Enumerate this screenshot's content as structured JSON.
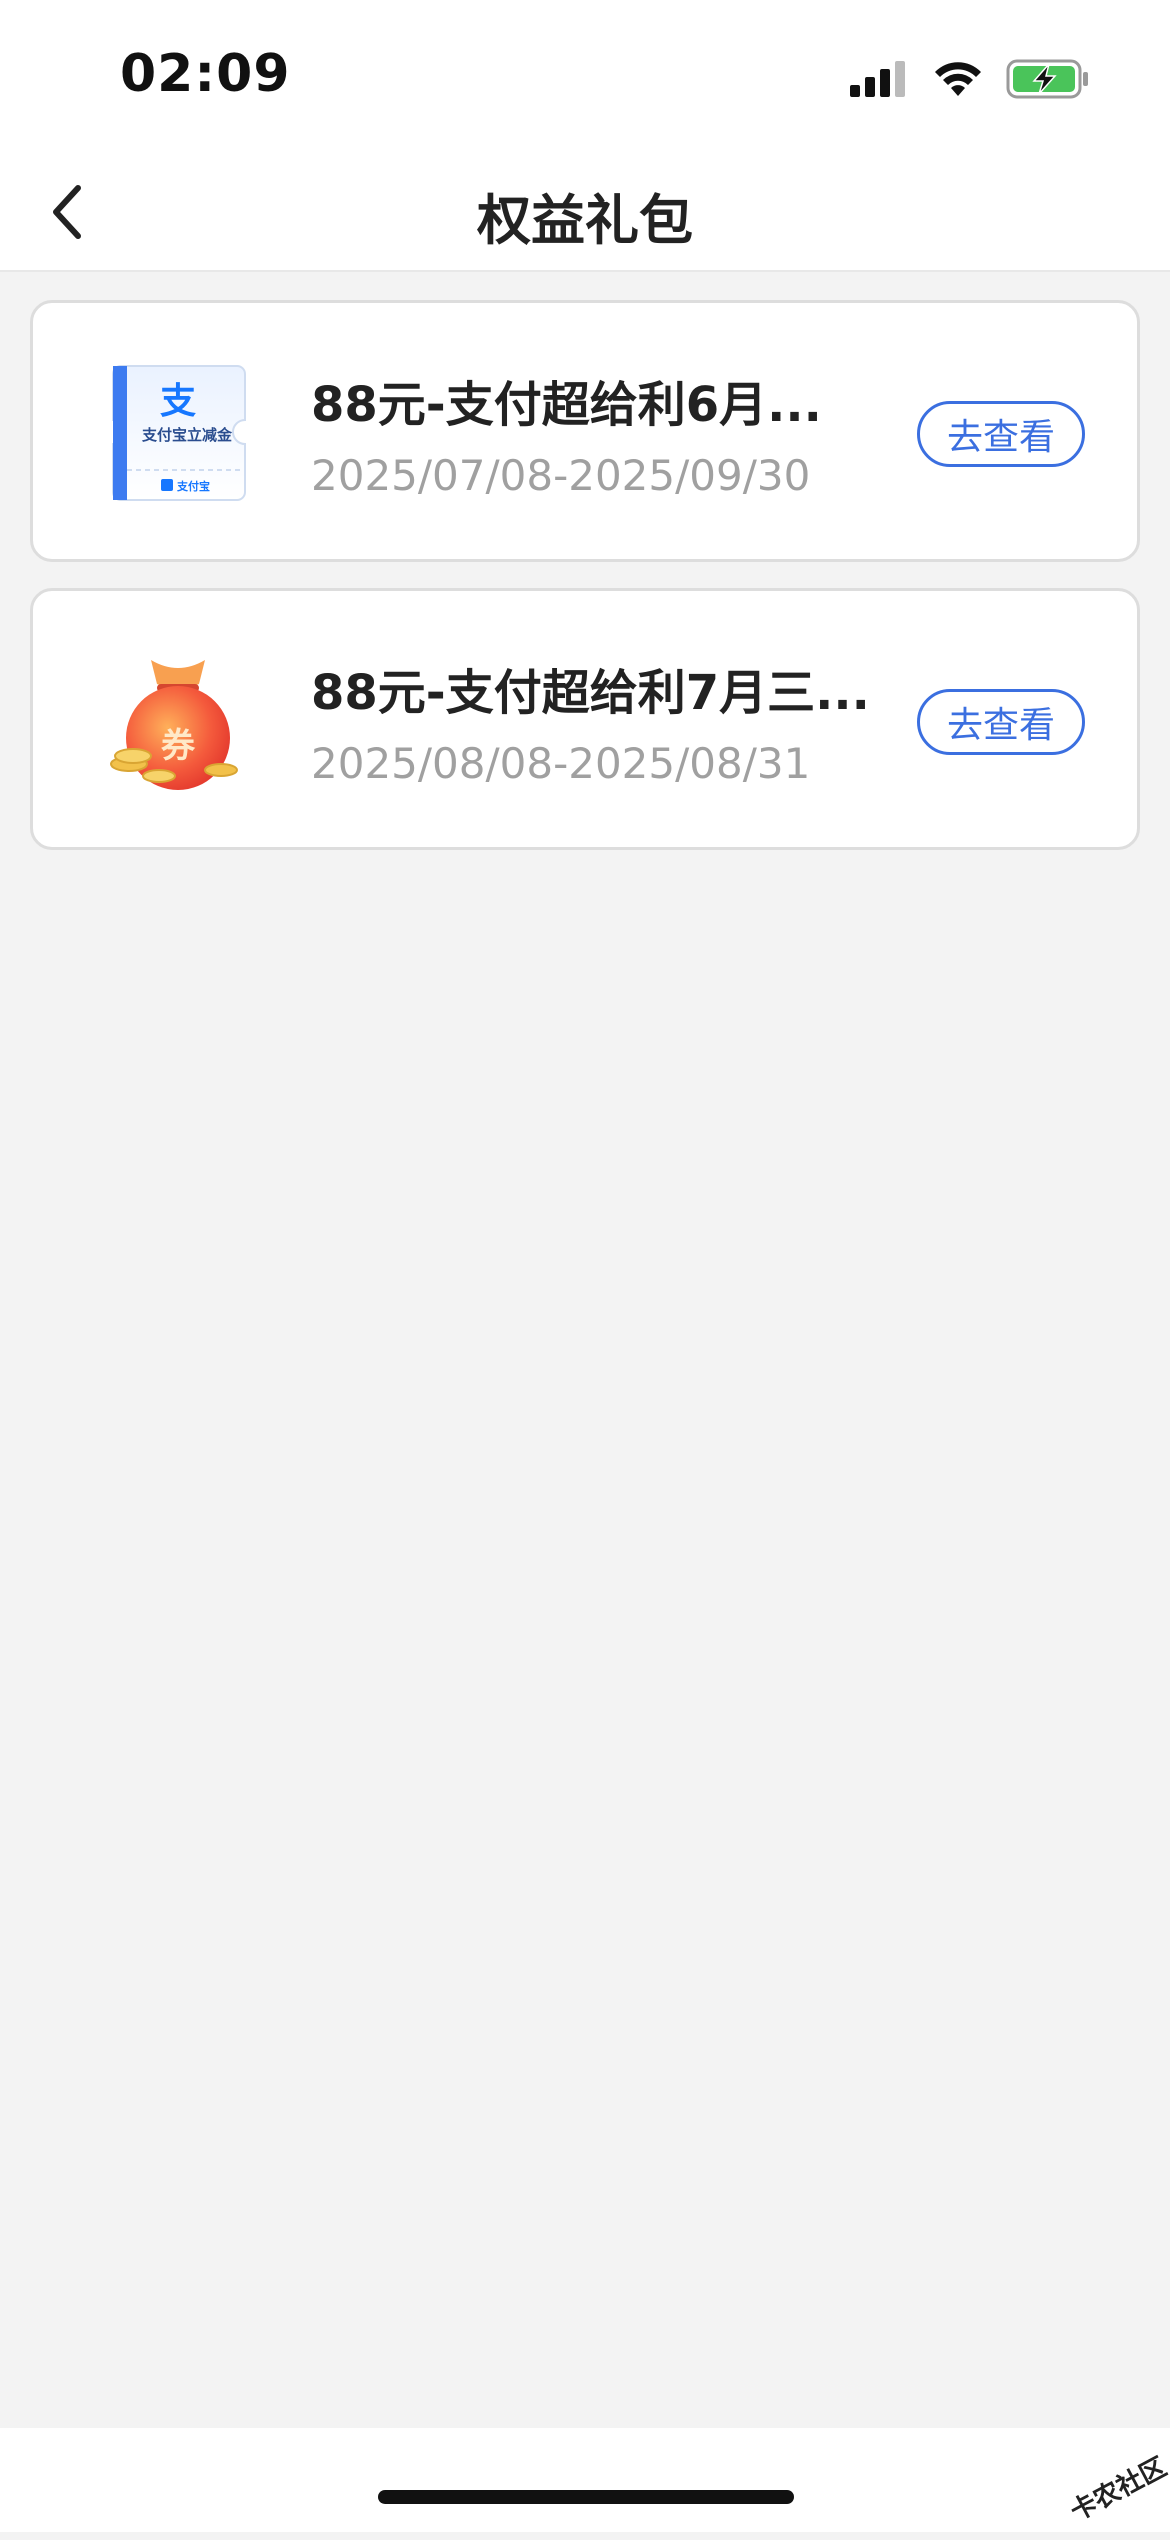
{
  "status_bar": {
    "time": "02:09",
    "icons": [
      "cellular-signal-icon",
      "wifi-icon",
      "battery-charging-icon"
    ]
  },
  "header": {
    "title": "权益礼包",
    "back_icon": "chevron-left-icon"
  },
  "items": [
    {
      "icon": "alipay-coupon-icon",
      "icon_text_top": "支",
      "icon_text_main": "支付宝立减金",
      "icon_text_brand": "支付宝",
      "title": "88元-支付超给利6月...",
      "date_range": "2025/07/08-2025/09/30",
      "action_label": "去查看"
    },
    {
      "icon": "red-coupon-bag-icon",
      "icon_text_main": "券",
      "title": "88元-支付超给利7月三...",
      "date_range": "2025/08/08-2025/08/31",
      "action_label": "去查看"
    }
  ],
  "watermark": {
    "text": "卡农社区"
  },
  "colors": {
    "accent": "#3b6fe0",
    "background": "#f3f3f3",
    "card": "#ffffff",
    "muted_text": "#a0a0a0"
  }
}
